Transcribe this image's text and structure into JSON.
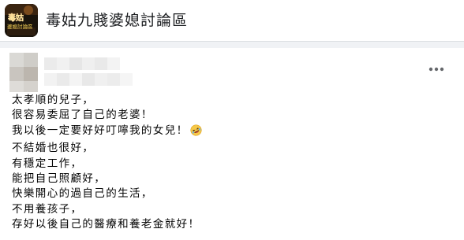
{
  "header": {
    "group_name": "毒姑九賤婆媳討論區",
    "thumb_text_line1": "毒姑",
    "thumb_text_line2": "婆媳討論區"
  },
  "post": {
    "author": "",
    "lines": [
      "太孝順的兒子，",
      "很容易委屈了自己的老婆！",
      "我以後一定要好好叮嚀我的女兒！",
      "不結婚也很好，",
      "有穩定工作，",
      "能把自己照顧好，",
      "快樂開心的過自己的生活，",
      "不用養孩子，",
      "存好以後自己的醫療和養老金就好！"
    ],
    "line3_emoji": "rofl-emoji-icon",
    "more_icon": "more-options-icon"
  },
  "colors": {
    "page_gap": "#f0f2f5",
    "divider": "#dcdfe3",
    "text": "#050505",
    "icon_gray": "#65676b",
    "emoji_yellow": "#f7c948"
  }
}
